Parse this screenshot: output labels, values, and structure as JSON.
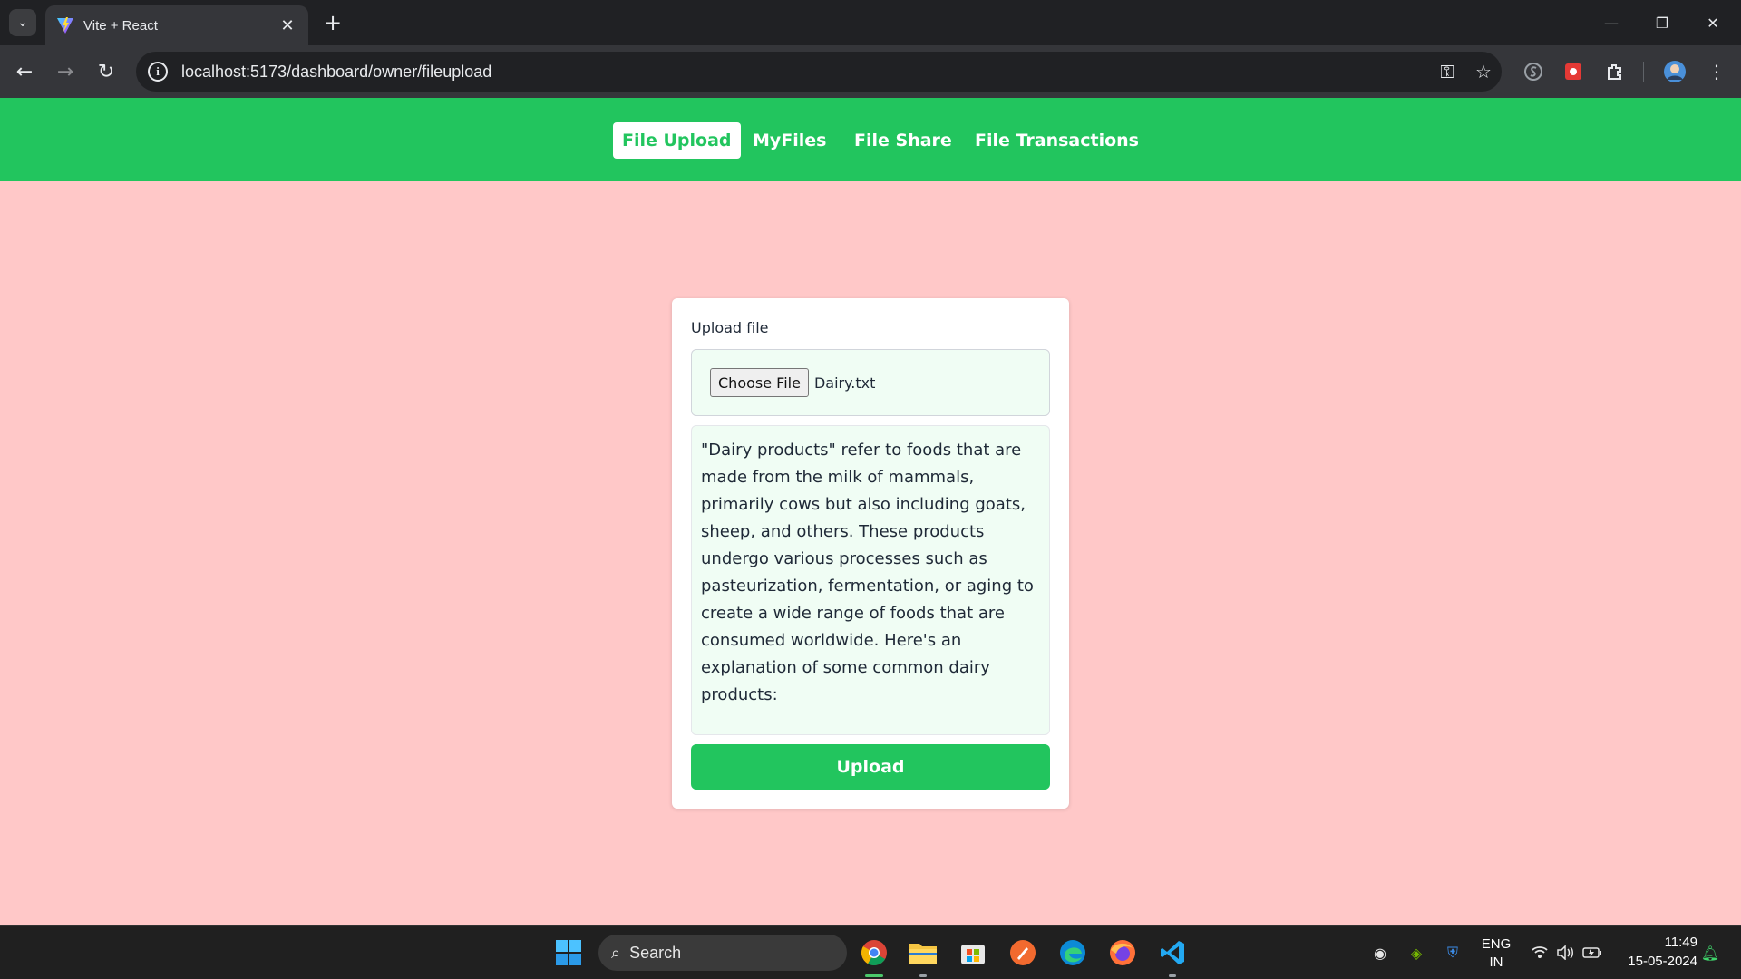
{
  "browser": {
    "tab_title": "Vite + React",
    "tab_close": "✕",
    "new_tab": "+",
    "url": "localhost:5173/dashboard/owner/fileupload",
    "window_controls": {
      "minimize": "—",
      "restore": "❐",
      "close": "✕"
    }
  },
  "nav": {
    "links": [
      {
        "label": "File Upload",
        "active": true
      },
      {
        "label": "MyFiles",
        "active": false
      },
      {
        "label": "File Share",
        "active": false
      },
      {
        "label": "File Transactions",
        "active": false
      }
    ]
  },
  "upload_form": {
    "label": "Upload file",
    "choose_button": "Choose File",
    "file_name": "Dairy.txt",
    "preview_text": "\"Dairy products\" refer to foods that are made from the milk of mammals, primarily cows but also including goats, sheep, and others. These products undergo various processes such as pasteurization, fermentation, or aging to create a wide range of foods that are consumed worldwide. Here's an explanation of some common dairy products:",
    "submit_button": "Upload"
  },
  "taskbar": {
    "search_label": "Search",
    "language": "ENG",
    "region": "IN",
    "time": "11:49",
    "date": "15-05-2024"
  },
  "colors": {
    "accent": "#22c55e",
    "page_background": "#ffc8c8",
    "field_background": "#f0fdf4"
  }
}
